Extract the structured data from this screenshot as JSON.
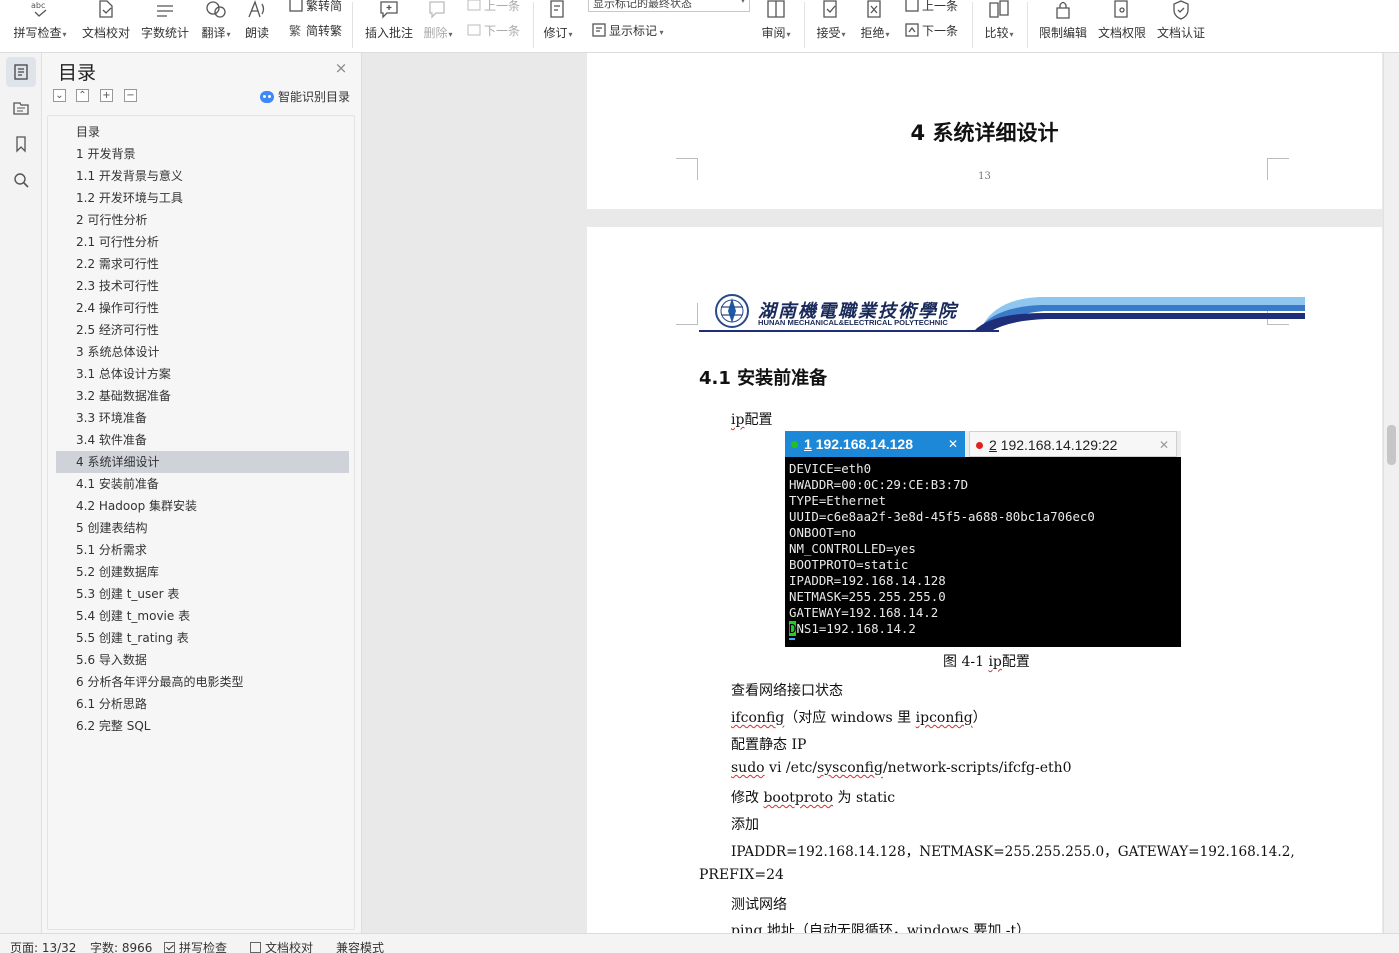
{
  "ribbon": {
    "spell_check": "拼写检查",
    "doc_proof": "文档校对",
    "word_count": "字数统计",
    "translate": "翻译",
    "read_aloud": "朗读",
    "trad_to_simp": "繁转简",
    "simp_to_trad": "简转繁",
    "insert_comment": "插入批注",
    "delete": "删除",
    "prev": "上一条",
    "next": "下一条",
    "track_changes": "修订",
    "markup_state": "显示标记的最终状态",
    "show_markup": "显示标记",
    "review": "审阅",
    "accept": "接受",
    "reject": "拒绝",
    "prev_change": "上一条",
    "next_change": "下一条",
    "compare": "比较",
    "restrict_edit": "限制编辑",
    "doc_permission": "文档权限",
    "doc_cert": "文档认证"
  },
  "toc": {
    "title": "目录",
    "smart_label": "智能识别目录",
    "active_index": 15,
    "items": [
      "目录",
      "1  开发背景",
      "1.1 开发背景与意义",
      "1.2  开发环境与工具",
      "2  可行性分析",
      "  2.1  可行性分析",
      "2.2  需求可行性",
      "2.3  技术可行性",
      "2.4  操作可行性",
      "2.5 经济可行性",
      "3  系统总体设计",
      "3.1  总体设计方案",
      "3.2  基础数据准备",
      "3.3  环境准备",
      "3.4  软件准备",
      "4  系统详细设计",
      "4.1  安装前准备",
      "4.2 Hadoop 集群安装",
      "5  创建表结构",
      "5.1  分析需求",
      "5.2  创建数据库",
      "5.3  创建 t_user 表",
      "5.4  创建 t_movie 表",
      "5.5  创建 t_rating 表",
      "5.6  导入数据",
      "6  分析各年评分最高的电影类型",
      "6.1  分析思路",
      "6.2  完整 SQL"
    ]
  },
  "page1": {
    "heading": "4  系统详细设计",
    "page_number": "13"
  },
  "page2": {
    "banner_name": "湖南機電職業技術學院",
    "banner_sub": "HUNAN MECHANICAL&ELECTRICAL POLYTECHNIC",
    "section_heading": "4.1  安装前准备",
    "ip_config_pre": "ip",
    "ip_config_post": "配置",
    "terminal": {
      "tab1_num": "1",
      "tab1_label": " 192.168.14.128",
      "tab2_num": "2",
      "tab2_label": " 192.168.14.129:22",
      "lines": [
        "DEVICE=eth0",
        "HWADDR=00:0C:29:CE:B3:7D",
        "TYPE=Ethernet",
        "UUID=c6e8aa2f-3e8d-45f5-a688-80bc1a706ec0",
        "ONBOOT=no",
        "NM_CONTROLLED=yes",
        "BOOTPROTO=static",
        "IPADDR=192.168.14.128",
        "NETMASK=255.255.255.0",
        "GATEWAY=192.168.14.2"
      ],
      "last_cursor": "D",
      "last_rest": "NS1=192.168.14.2"
    },
    "caption_pre": "图 4-1 ",
    "caption_ip": "ip",
    "caption_post": "配置",
    "p1": "查看网络接口状态",
    "p2_a": "ifconfig",
    "p2_b": "（对应 windows 里 ",
    "p2_c": "ipconfig",
    "p2_d": "）",
    "p3": "配置静态 IP",
    "p4_a": "sudo",
    "p4_b": " vi /etc/",
    "p4_c": "sysconfig",
    "p4_d": "/network-scripts/ifcfg-eth0",
    "p5_a": "修改 ",
    "p5_b": "bootproto",
    "p5_c": " 为 static",
    "p6": "添加",
    "p7": "IPADDR=192.168.14.128，NETMASK=255.255.255.0，GATEWAY=192.168.14.2,",
    "p8": "PREFIX=24",
    "p9": "测试网络",
    "p10_a": "ping",
    "p10_b": " 地址（自动无限循环，windows 要加 -t）"
  },
  "status": {
    "page": "页面: 13/32",
    "words": "字数: 8966",
    "spell": "拼写检查",
    "proof": "文档校对",
    "compat": "兼容模式"
  },
  "colors": {
    "tab_active": "#1e88d8",
    "tab_dot_green": "#22c022",
    "tab_dot_red": "#e02020",
    "toc_active": "#cfd3d9",
    "banner_blue": "#1a2a5a"
  }
}
